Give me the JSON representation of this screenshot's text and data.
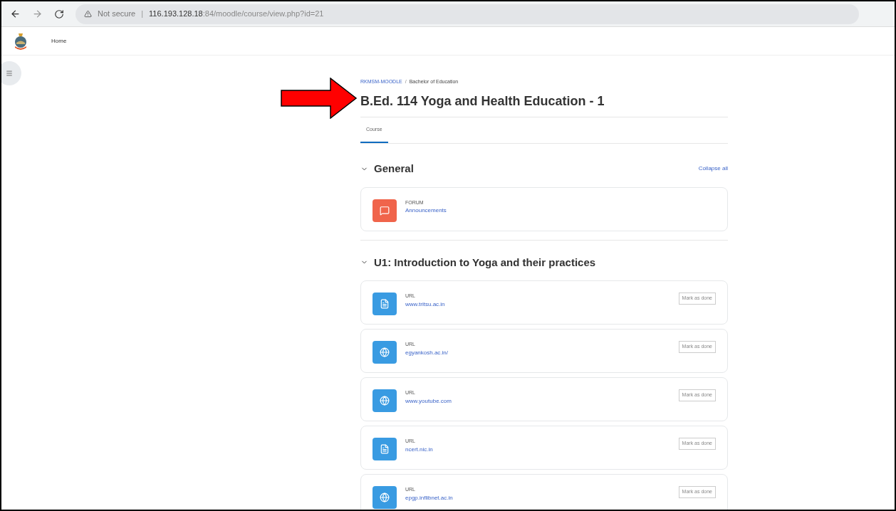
{
  "browser": {
    "security": "Not secure",
    "separator": "|",
    "url_host": "116.193.128.18",
    "url_rest": ":84/moodle/course/view.php?id=21"
  },
  "navbar": {
    "items": [
      {
        "label": "Home",
        "selected": false
      }
    ]
  },
  "breadcrumb": [
    "RKMSM-MOODLE",
    "Bachelor of Education"
  ],
  "breadcrumb_separator": "/",
  "course_title": "B.Ed. 114 Yoga and Health Education - 1",
  "tabs": [
    {
      "label": "Course",
      "selected": true
    }
  ],
  "collapse_all": "Collapse all",
  "sections": [
    {
      "title": "General",
      "expanded": true,
      "activities": [
        {
          "kind": "forum",
          "type": "FORUM",
          "name": "Announcements"
        }
      ]
    },
    {
      "title": "U1: Introduction to Yoga and their practices",
      "expanded": true,
      "activities": [
        {
          "kind": "page",
          "type": "URL",
          "name": "www.tritsu.ac.in",
          "button": "Mark as done"
        },
        {
          "kind": "globe",
          "type": "URL",
          "name": "egyankosh.ac.in/",
          "button": "Mark as done"
        },
        {
          "kind": "globe",
          "type": "URL",
          "name": "www.youtube.com",
          "button": "Mark as done"
        },
        {
          "kind": "page",
          "type": "URL",
          "name": "ncert.nic.in",
          "button": "Mark as done"
        },
        {
          "kind": "globe",
          "type": "URL",
          "name": "epgp.inflibnet.ac.in",
          "button": "Mark as done"
        }
      ]
    }
  ]
}
